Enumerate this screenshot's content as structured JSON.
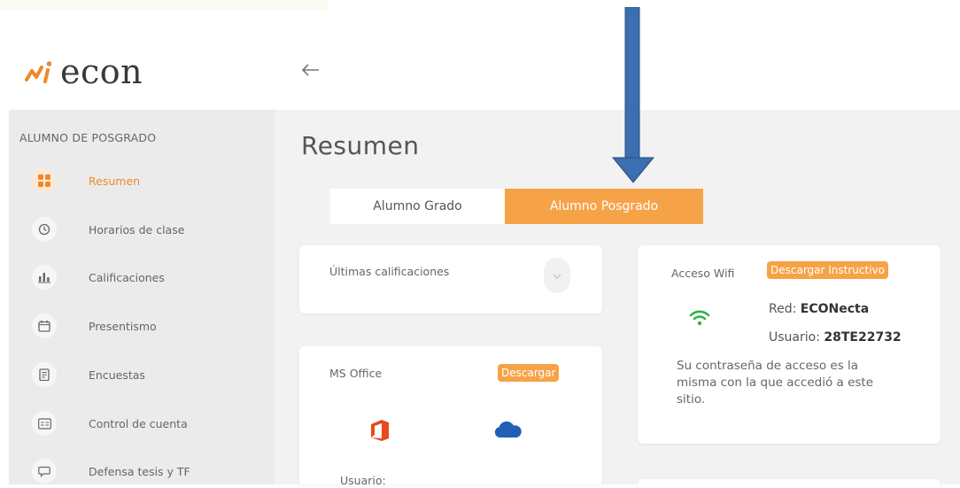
{
  "brand": {
    "name": "econ"
  },
  "header": {
    "back_icon": "arrow-left-icon"
  },
  "sidebar": {
    "title": "ALUMNO DE POSGRADO",
    "items": [
      {
        "label": "Resumen",
        "icon": "grid-icon",
        "active": true
      },
      {
        "label": "Horarios de clase",
        "icon": "clock-icon",
        "active": false
      },
      {
        "label": "Calificaciones",
        "icon": "bar-chart-icon",
        "active": false
      },
      {
        "label": "Presentismo",
        "icon": "calendar-icon",
        "active": false
      },
      {
        "label": "Encuestas",
        "icon": "clipboard-icon",
        "active": false
      },
      {
        "label": "Control de cuenta",
        "icon": "id-card-icon",
        "active": false
      },
      {
        "label": "Defensa tesis y TF",
        "icon": "chat-bubble-icon",
        "active": false
      }
    ]
  },
  "main": {
    "title": "Resumen",
    "tabs": [
      {
        "label": "Alumno Grado",
        "selected": false
      },
      {
        "label": "Alumno Posgrado",
        "selected": true
      }
    ],
    "grades_card": {
      "title": "Últimas calificaciones"
    },
    "office_card": {
      "title": "MS Office",
      "download_label": "Descargar",
      "user_label": "Usuario:"
    },
    "wifi_card": {
      "title": "Acceso Wifi",
      "download_label": "Descargar Instructivo",
      "network_label": "Red:",
      "network_value": "ECONecta",
      "user_label": "Usuario:",
      "user_value": "28TE22732",
      "note": "Su contraseña de acceso es la misma con la que accedió a este sitio."
    }
  },
  "colors": {
    "accent": "#f6a348",
    "accent_text": "#f0872a",
    "wifi_green": "#2fb34a",
    "office_red": "#e8491d",
    "onedrive_blue": "#1f5fb6",
    "annotation_arrow": "#3a6fb0"
  }
}
